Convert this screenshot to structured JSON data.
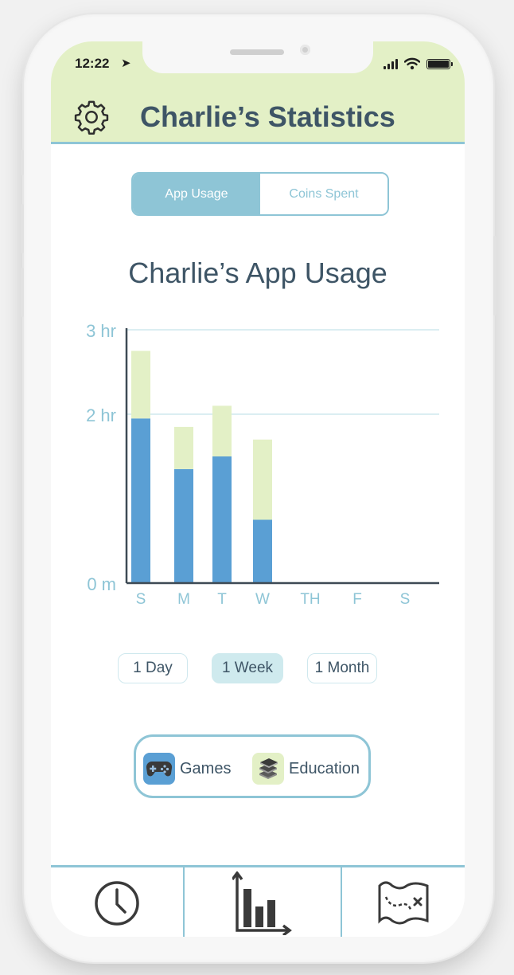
{
  "status_bar": {
    "time": "12:22"
  },
  "header": {
    "title": "Charlie’s Statistics"
  },
  "toggle": {
    "options": [
      "App Usage",
      "Coins Spent"
    ],
    "selected": "App Usage"
  },
  "chart_data": {
    "type": "bar",
    "stacked": true,
    "title": "Charlie’s App Usage",
    "categories": [
      "S",
      "M",
      "T",
      "W",
      "TH",
      "F",
      "S"
    ],
    "y_ticks": [
      "0 m",
      "2 hr",
      "3 hr"
    ],
    "ylim": [
      0,
      3
    ],
    "grid": "horizontal at 2 hr and 3 hr",
    "series": [
      {
        "name": "Games",
        "values": [
          1.95,
          1.35,
          1.5,
          0.75,
          0,
          0,
          0
        ],
        "color": "#5a9fd4"
      },
      {
        "name": "Education",
        "values": [
          0.8,
          0.5,
          0.6,
          0.95,
          0,
          0,
          0
        ],
        "color": "#e3f0c6"
      }
    ]
  },
  "time_range": {
    "options": [
      "1 Day",
      "1 Week",
      "1 Month"
    ],
    "selected": "1 Week"
  },
  "legend": [
    {
      "label": "Games",
      "icon": "gamepad-icon",
      "color": "#5a9fd4"
    },
    {
      "label": "Education",
      "icon": "books-icon",
      "color": "#e3f0c6"
    }
  ],
  "tabbar": {
    "tabs": [
      {
        "icon": "clock-icon"
      },
      {
        "icon": "bar-chart-icon",
        "active": true
      },
      {
        "icon": "treasure-map-icon"
      }
    ]
  },
  "colors": {
    "accent": "#8ec5d6",
    "header_bg": "#e3f0c6",
    "text": "#3e5566",
    "games": "#5a9fd4",
    "education": "#e3f0c6"
  }
}
